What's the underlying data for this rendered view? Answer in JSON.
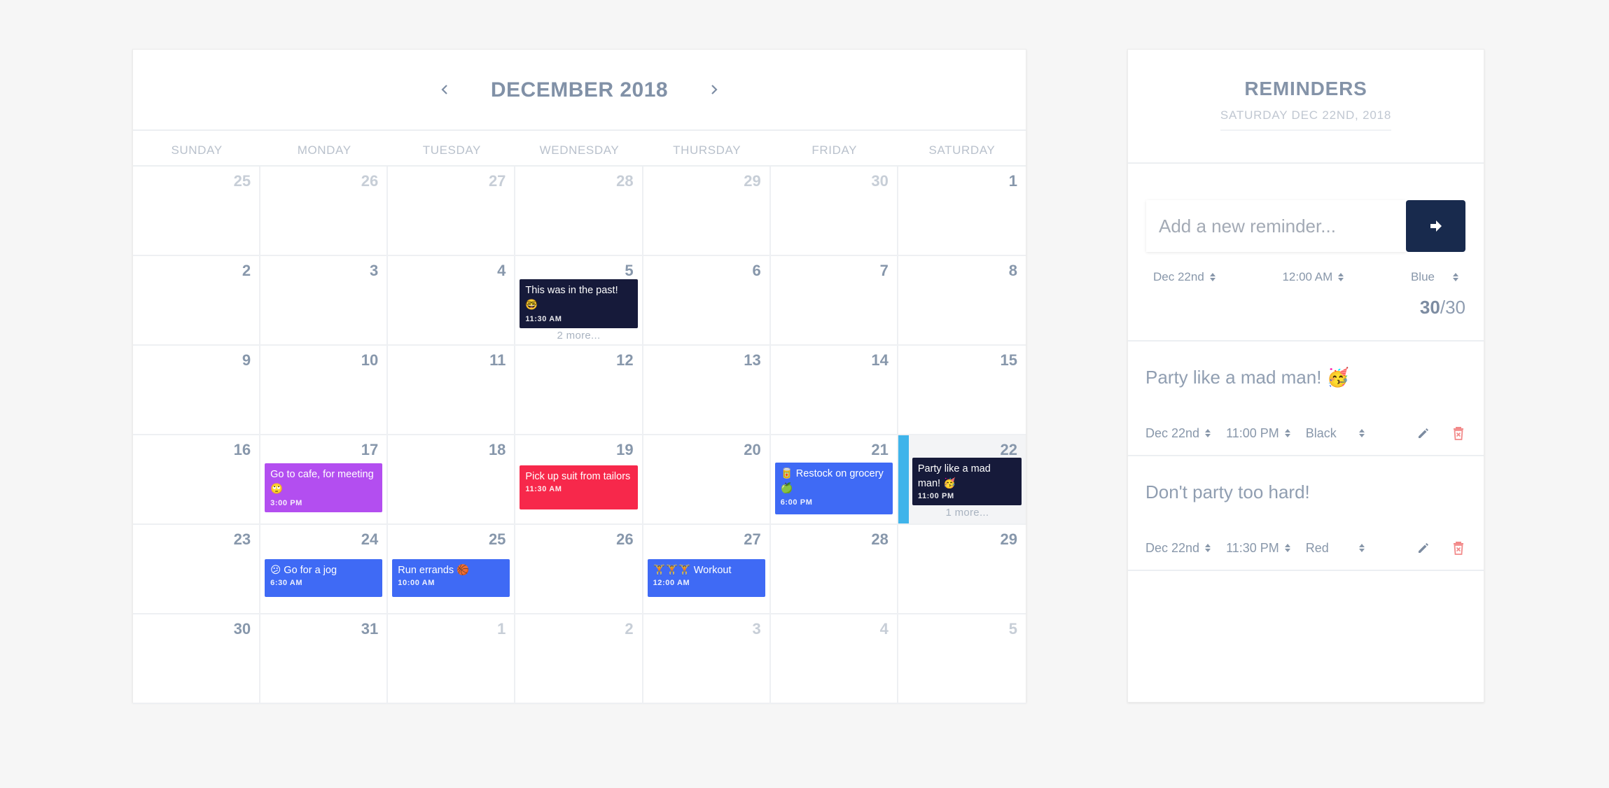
{
  "calendar": {
    "title": "DECEMBER 2018",
    "weekdays": [
      "SUNDAY",
      "MONDAY",
      "TUESDAY",
      "WEDNESDAY",
      "THURSDAY",
      "FRIDAY",
      "SATURDAY"
    ],
    "days": [
      "25",
      "26",
      "27",
      "28",
      "29",
      "30",
      "1",
      "2",
      "3",
      "4",
      "5",
      "6",
      "7",
      "8",
      "9",
      "10",
      "11",
      "12",
      "13",
      "14",
      "15",
      "16",
      "17",
      "18",
      "19",
      "20",
      "21",
      "22",
      "23",
      "24",
      "25",
      "26",
      "27",
      "28",
      "29",
      "30",
      "31",
      "1",
      "2",
      "3",
      "4",
      "5"
    ],
    "events": {
      "past": {
        "text": "This was in the past! 🤓",
        "time": "11:30 AM",
        "more": "2 more...",
        "color": "#161a3a"
      },
      "cafe": {
        "text": "Go to cafe, for meeting 🙄",
        "time": "3:00 PM",
        "color": "#b34ef0"
      },
      "suit": {
        "text": "Pick up suit from tailors",
        "time": "11:30 AM",
        "color": "#f7284b"
      },
      "grocery": {
        "text": "🥫 Restock on grocery 🍏",
        "time": "6:00 PM",
        "color": "#3f6af5"
      },
      "party": {
        "text": "Party like a mad man! 🥳",
        "time": "11:00 PM",
        "more": "1 more...",
        "color": "#161a3a"
      },
      "jog": {
        "text": "😕 Go for a jog",
        "time": "6:30 AM",
        "color": "#3f6af5"
      },
      "errands": {
        "text": "Run errands 🏀",
        "time": "10:00 AM",
        "color": "#3f6af5"
      },
      "workout": {
        "text": "🏋🏋🏋 Workout",
        "time": "12:00 AM",
        "color": "#3f6af5"
      }
    }
  },
  "reminders": {
    "title": "REMINDERS",
    "date": "SATURDAY DEC 22ND, 2018",
    "input_placeholder": "Add a new reminder...",
    "new": {
      "date": "Dec 22nd",
      "time": "12:00 AM",
      "color": "Blue",
      "count": "30",
      "max": "/30"
    },
    "items": [
      {
        "text": "Party like a mad man! 🥳",
        "date": "Dec 22nd",
        "time": "11:00 PM",
        "color": "Black"
      },
      {
        "text": "Don't party too hard!",
        "date": "Dec 22nd",
        "time": "11:30 PM",
        "color": "Red"
      }
    ],
    "accent": "#182a4d",
    "delete_color": "#f28a8a"
  }
}
